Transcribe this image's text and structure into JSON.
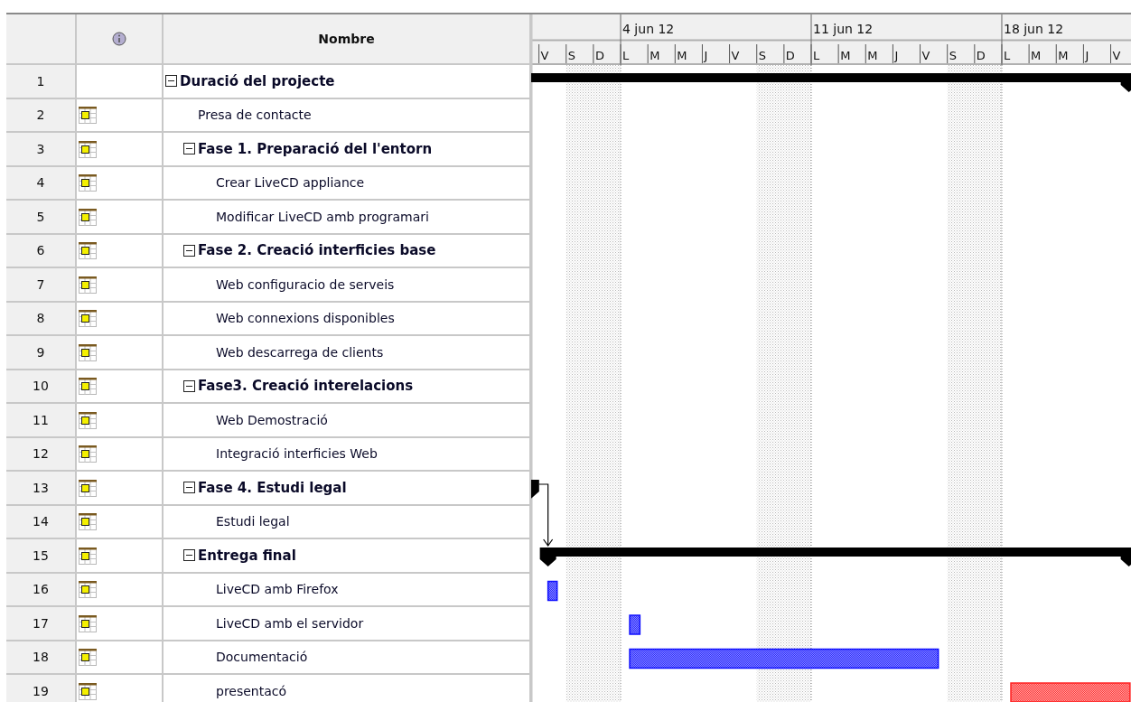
{
  "table": {
    "name_header": "Nombre"
  },
  "timeline": {
    "weeks": [
      {
        "days": [
          {
            "label": "V",
            "kind": "workday"
          },
          {
            "label": "S",
            "kind": "weekend"
          },
          {
            "label": "D",
            "kind": "weekend"
          }
        ]
      },
      {
        "label": "4 jun 12",
        "days": [
          {
            "label": "L",
            "kind": "workday"
          },
          {
            "label": "M",
            "kind": "workday"
          },
          {
            "label": "M",
            "kind": "workday"
          },
          {
            "label": "J",
            "kind": "workday"
          },
          {
            "label": "V",
            "kind": "workday"
          },
          {
            "label": "S",
            "kind": "weekend"
          },
          {
            "label": "D",
            "kind": "weekend"
          }
        ]
      },
      {
        "label": "11 jun 12",
        "days": [
          {
            "label": "L",
            "kind": "workday"
          },
          {
            "label": "M",
            "kind": "workday"
          },
          {
            "label": "M",
            "kind": "workday"
          },
          {
            "label": "J",
            "kind": "workday"
          },
          {
            "label": "V",
            "kind": "workday"
          },
          {
            "label": "S",
            "kind": "weekend"
          },
          {
            "label": "D",
            "kind": "weekend"
          }
        ]
      },
      {
        "label": "18 jun 12",
        "days": [
          {
            "label": "L",
            "kind": "workday"
          },
          {
            "label": "M",
            "kind": "workday"
          },
          {
            "label": "M",
            "kind": "workday"
          },
          {
            "label": "J",
            "kind": "workday"
          },
          {
            "label": "V",
            "kind": "workday"
          }
        ]
      }
    ]
  },
  "tasks": [
    {
      "number": "1",
      "name": "Duració del projecte",
      "indicator": false,
      "expanded": true,
      "bar": {
        "kind": "summary"
      },
      "children": [
        {
          "number": "2",
          "name": "Presa de contacte",
          "indicator": true
        },
        {
          "number": "3",
          "name": "Fase 1. Preparació del l'entorn",
          "indicator": true,
          "expanded": true,
          "children": [
            {
              "number": "4",
              "name": "Crear LiveCD appliance",
              "indicator": true
            },
            {
              "number": "5",
              "name": "Modificar LiveCD amb programari",
              "indicator": true
            }
          ]
        },
        {
          "number": "6",
          "name": "Fase 2. Creació interficies base",
          "indicator": true,
          "expanded": true,
          "children": [
            {
              "number": "7",
              "name": "Web configuracio de serveis",
              "indicator": true
            },
            {
              "number": "8",
              "name": "Web connexions disponibles",
              "indicator": true
            },
            {
              "number": "9",
              "name": "Web descarrega de clients",
              "indicator": true
            }
          ]
        },
        {
          "number": "10",
          "name": "Fase3. Creació interelacions",
          "indicator": true,
          "expanded": true,
          "children": [
            {
              "number": "11",
              "name": "Web Demostració",
              "indicator": true
            },
            {
              "number": "12",
              "name": "Integració interficies Web",
              "indicator": true
            }
          ]
        },
        {
          "number": "13",
          "name": "Fase 4. Estudi legal",
          "indicator": true,
          "expanded": true,
          "link_to_next": true,
          "bar": {
            "kind": "summary"
          },
          "children": [
            {
              "number": "14",
              "name": "Estudi legal",
              "indicator": true
            }
          ]
        },
        {
          "number": "15",
          "name": "Entrega final",
          "indicator": true,
          "expanded": true,
          "bar": {
            "kind": "summary"
          },
          "children": [
            {
              "number": "16",
              "name": "LiveCD amb Firefox",
              "indicator": true,
              "bar": {
                "kind": "task"
              }
            },
            {
              "number": "17",
              "name": "LiveCD amb el servidor",
              "indicator": true,
              "bar": {
                "kind": "task"
              }
            },
            {
              "number": "18",
              "name": "Documentació",
              "indicator": true,
              "bar": {
                "kind": "task"
              }
            },
            {
              "number": "19",
              "name": "presentacó",
              "indicator": true,
              "bar": {
                "kind": "critical"
              }
            }
          ]
        }
      ]
    }
  ]
}
